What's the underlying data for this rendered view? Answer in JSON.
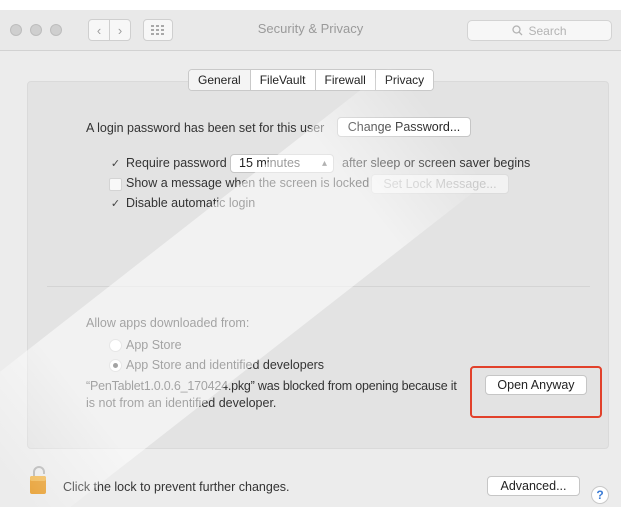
{
  "window": {
    "title": "Security & Privacy",
    "search_placeholder": "Search"
  },
  "tabs": [
    {
      "label": "General",
      "active": true
    },
    {
      "label": "FileVault",
      "active": false
    },
    {
      "label": "Firewall",
      "active": false
    },
    {
      "label": "Privacy",
      "active": false
    }
  ],
  "general": {
    "login_password_text": "A login password has been set for this user",
    "change_password_label": "Change Password...",
    "require_password": {
      "label": "Require password",
      "checked": true
    },
    "require_delay": "15 minutes",
    "after_sleep_text": "after sleep or screen saver begins",
    "show_message": {
      "label": "Show a message when the screen is locked",
      "checked": false
    },
    "set_lock_message_label": "Set Lock Message...",
    "disable_auto_login": {
      "label": "Disable automatic login",
      "checked": true
    }
  },
  "allow_apps": {
    "heading": "Allow apps downloaded from:",
    "options": [
      {
        "label": "App Store",
        "selected": false
      },
      {
        "label": "App Store and identified developers",
        "selected": true
      }
    ],
    "blocked_line1": "“PenTablet1.0.0.6_170424.pkg” was blocked from opening because it",
    "blocked_line2": "is not from an identified developer.",
    "open_anyway_label": "Open Anyway",
    "highlight_color": "#e2412b"
  },
  "footer": {
    "lock_text": "Click the lock to prevent further changes.",
    "advanced_label": "Advanced...",
    "help_label": "?"
  }
}
